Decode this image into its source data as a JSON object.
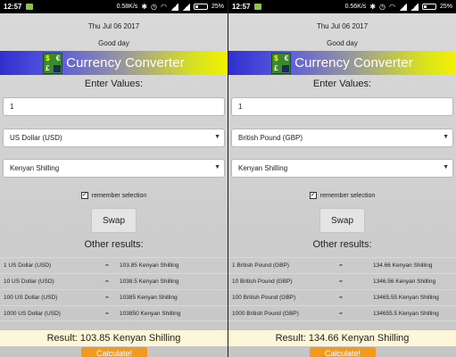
{
  "left": {
    "status": {
      "time": "12:57",
      "speed": "0.58K/s",
      "battery": "25%"
    },
    "date": "Thu Jul 06 2017",
    "greeting": "Good day",
    "title": "Currency Converter",
    "enter_values": "Enter Values:",
    "amount": "1",
    "from": "US Dollar (USD)",
    "to": "Kenyan Shilling",
    "remember": "remember selection",
    "swap": "Swap",
    "other_results": "Other results:",
    "rows": [
      {
        "lhs": "1 US Dollar (USD)",
        "eq": "=",
        "rhs": "103.85 Kenyan Shilling"
      },
      {
        "lhs": "10 US Dollar (USD)",
        "eq": "=",
        "rhs": "1038.5 Kenyan Shilling"
      },
      {
        "lhs": "100 US Dollar (USD)",
        "eq": "=",
        "rhs": "10385 Kenyan Shilling"
      },
      {
        "lhs": "1000 US Dollar (USD)",
        "eq": "=",
        "rhs": "103850 Kenyan Shilling"
      }
    ],
    "result": "Result: 103.85 Kenyan Shilling",
    "calculate": "Calculate!"
  },
  "right": {
    "status": {
      "time": "12:57",
      "speed": "0.56K/s",
      "battery": "25%"
    },
    "date": "Thu Jul 06 2017",
    "greeting": "Good day",
    "title": "Currency Converter",
    "enter_values": "Enter Values:",
    "amount": "1",
    "from": "British Pound (GBP)",
    "to": "Kenyan Shilling",
    "remember": "remember selection",
    "swap": "Swap",
    "other_results": "Other results:",
    "rows": [
      {
        "lhs": "1 British Pound (GBP)",
        "eq": "=",
        "rhs": "134.66 Kenyan Shilling"
      },
      {
        "lhs": "10 British Pound (GBP)",
        "eq": "=",
        "rhs": "1346.56 Kenyan Shilling"
      },
      {
        "lhs": "100 British Pound (GBP)",
        "eq": "=",
        "rhs": "13465.55 Kenyan Shilling"
      },
      {
        "lhs": "1000 British Pound (GBP)",
        "eq": "=",
        "rhs": "134655.5 Kenyan Shilling"
      }
    ],
    "result": "Result: 134.66 Kenyan Shilling",
    "calculate": "Calculate!"
  },
  "icons": {
    "wifi": "wifi-icon",
    "bluetooth": "bluetooth-icon",
    "alarm": "alarm-icon",
    "battery": "battery-icon",
    "logo": "currency-logo-icon"
  },
  "colors": {
    "banner_start": "#2f2fcf",
    "banner_end": "#f2f200",
    "calculate_button": "#f39a1e",
    "result_bar": "#fdf6d8"
  }
}
